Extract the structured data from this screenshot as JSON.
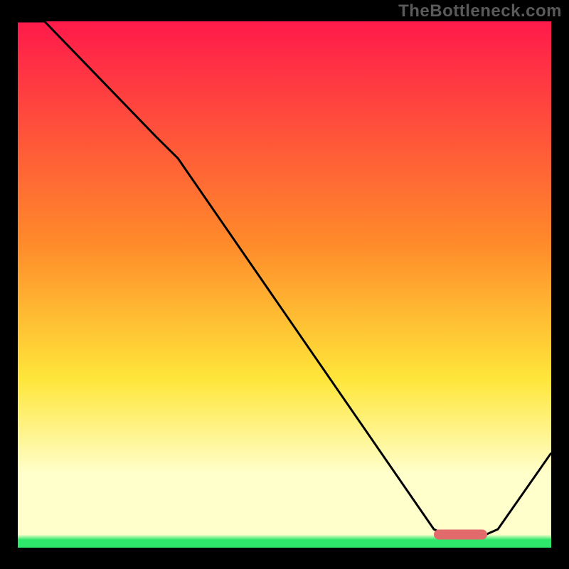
{
  "watermark": "TheBottleneck.com",
  "colors": {
    "red": "#ff1a4b",
    "orange": "#ff8a2a",
    "yellow": "#ffe63a",
    "pale": "#ffffcc",
    "green": "#2ee86b",
    "curve": "#000000",
    "marker": "#e26a6a",
    "frame": "#000000"
  },
  "chart_data": {
    "type": "line",
    "title": "",
    "xlabel": "",
    "ylabel": "",
    "xlim": [
      0,
      100
    ],
    "ylim": [
      0,
      100
    ],
    "x": [
      0,
      5,
      26,
      30,
      78,
      80,
      88,
      90,
      100
    ],
    "values": [
      100,
      100,
      78,
      74,
      3.5,
      2.5,
      2.6,
      3.5,
      18
    ],
    "optimal_band": {
      "x_start": 78,
      "x_end": 88,
      "y": 2.5
    }
  }
}
